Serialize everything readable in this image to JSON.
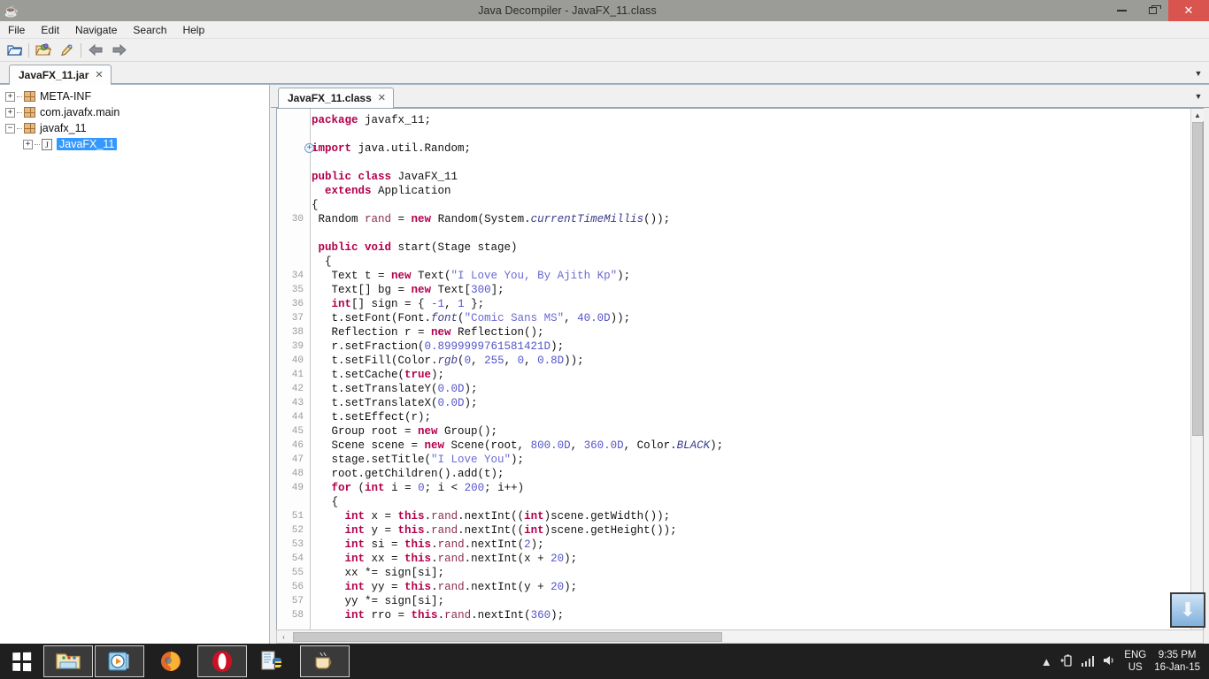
{
  "window": {
    "title": "Java Decompiler - JavaFX_11.class",
    "app_icon": "java-cup-icon",
    "controls": {
      "minimize": "minimize-icon",
      "restore": "restore-icon",
      "close": "✕"
    }
  },
  "menubar": {
    "items": [
      "File",
      "Edit",
      "Navigate",
      "Search",
      "Help"
    ]
  },
  "toolbar": {
    "items": [
      {
        "name": "open-file-icon",
        "glyph": "📂"
      },
      {
        "name": "open-type-icon",
        "glyph": "📁"
      },
      {
        "name": "pin-icon",
        "glyph": "🖊"
      },
      {
        "name": "back-arrow-icon",
        "glyph": "⬅"
      },
      {
        "name": "forward-arrow-icon",
        "glyph": "➡"
      }
    ]
  },
  "left_panel": {
    "tab": {
      "label": "JavaFX_11.jar",
      "close": "✕"
    },
    "dropdown": "▼",
    "tree": [
      {
        "label": "META-INF",
        "icon": "package-icon",
        "expander": "+",
        "level": 1,
        "selected": false
      },
      {
        "label": "com.javafx.main",
        "icon": "package-icon",
        "expander": "+",
        "level": 1,
        "selected": false
      },
      {
        "label": "javafx_11",
        "icon": "package-icon",
        "expander": "−",
        "level": 1,
        "selected": false
      },
      {
        "label": "JavaFX_11",
        "icon": "class-icon",
        "expander": "+",
        "level": 2,
        "selected": true,
        "icon_glyph": "J"
      }
    ]
  },
  "editor": {
    "tab": {
      "label": "JavaFX_11.class",
      "close": "✕"
    },
    "dropdown": "▼",
    "fold_marker": "+",
    "scroll": {
      "up": "▲",
      "down": "▼",
      "left": "‹",
      "right": "›"
    },
    "corner_widget": "⬇",
    "lines": [
      {
        "no": "",
        "fold": false,
        "tokens": [
          {
            "t": "package ",
            "c": "kw"
          },
          {
            "t": "javafx_11;",
            "c": "plain"
          }
        ]
      },
      {
        "no": "",
        "fold": false,
        "tokens": []
      },
      {
        "no": "",
        "fold": true,
        "tokens": [
          {
            "t": "import ",
            "c": "kw"
          },
          {
            "t": "java.util.Random;",
            "c": "plain"
          }
        ]
      },
      {
        "no": "",
        "fold": false,
        "tokens": []
      },
      {
        "no": "",
        "fold": false,
        "tokens": [
          {
            "t": "public class ",
            "c": "kw"
          },
          {
            "t": "JavaFX_11",
            "c": "plain"
          }
        ]
      },
      {
        "no": "",
        "fold": false,
        "tokens": [
          {
            "t": "  ",
            "c": "plain"
          },
          {
            "t": "extends ",
            "c": "kw"
          },
          {
            "t": "Application",
            "c": "plain"
          }
        ]
      },
      {
        "no": "",
        "fold": false,
        "tokens": [
          {
            "t": "{",
            "c": "plain"
          }
        ]
      },
      {
        "no": "30",
        "fold": false,
        "tokens": [
          {
            "t": " Random ",
            "c": "plain"
          },
          {
            "t": "rand",
            "c": "fld"
          },
          {
            "t": " = ",
            "c": "plain"
          },
          {
            "t": "new ",
            "c": "kw"
          },
          {
            "t": "Random(System.",
            "c": "plain"
          },
          {
            "t": "currentTimeMillis",
            "c": "sfield"
          },
          {
            "t": "());",
            "c": "plain"
          }
        ]
      },
      {
        "no": "",
        "fold": false,
        "tokens": []
      },
      {
        "no": "",
        "fold": false,
        "tokens": [
          {
            "t": " ",
            "c": "plain"
          },
          {
            "t": "public void ",
            "c": "kw"
          },
          {
            "t": "start(Stage stage)",
            "c": "plain"
          }
        ]
      },
      {
        "no": "",
        "fold": false,
        "tokens": [
          {
            "t": "  {",
            "c": "plain"
          }
        ]
      },
      {
        "no": "34",
        "fold": false,
        "tokens": [
          {
            "t": "   Text t = ",
            "c": "plain"
          },
          {
            "t": "new ",
            "c": "kw"
          },
          {
            "t": "Text(",
            "c": "plain"
          },
          {
            "t": "\"I Love You, By Ajith Kp\"",
            "c": "str"
          },
          {
            "t": ");",
            "c": "plain"
          }
        ]
      },
      {
        "no": "35",
        "fold": false,
        "tokens": [
          {
            "t": "   Text[] bg = ",
            "c": "plain"
          },
          {
            "t": "new ",
            "c": "kw"
          },
          {
            "t": "Text[",
            "c": "plain"
          },
          {
            "t": "300",
            "c": "num"
          },
          {
            "t": "];",
            "c": "plain"
          }
        ]
      },
      {
        "no": "36",
        "fold": false,
        "tokens": [
          {
            "t": "   ",
            "c": "plain"
          },
          {
            "t": "int",
            "c": "kw"
          },
          {
            "t": "[] sign = { ",
            "c": "plain"
          },
          {
            "t": "-1",
            "c": "num"
          },
          {
            "t": ", ",
            "c": "plain"
          },
          {
            "t": "1",
            "c": "num"
          },
          {
            "t": " };",
            "c": "plain"
          }
        ]
      },
      {
        "no": "37",
        "fold": false,
        "tokens": [
          {
            "t": "   t.setFont(Font.",
            "c": "plain"
          },
          {
            "t": "font",
            "c": "sfield"
          },
          {
            "t": "(",
            "c": "plain"
          },
          {
            "t": "\"Comic Sans MS\"",
            "c": "str"
          },
          {
            "t": ", ",
            "c": "plain"
          },
          {
            "t": "40.0D",
            "c": "num"
          },
          {
            "t": "));",
            "c": "plain"
          }
        ]
      },
      {
        "no": "38",
        "fold": false,
        "tokens": [
          {
            "t": "   Reflection r = ",
            "c": "plain"
          },
          {
            "t": "new ",
            "c": "kw"
          },
          {
            "t": "Reflection();",
            "c": "plain"
          }
        ]
      },
      {
        "no": "39",
        "fold": false,
        "tokens": [
          {
            "t": "   r.setFraction(",
            "c": "plain"
          },
          {
            "t": "0.8999999761581421D",
            "c": "num"
          },
          {
            "t": ");",
            "c": "plain"
          }
        ]
      },
      {
        "no": "40",
        "fold": false,
        "tokens": [
          {
            "t": "   t.setFill(Color.",
            "c": "plain"
          },
          {
            "t": "rgb",
            "c": "sfield"
          },
          {
            "t": "(",
            "c": "plain"
          },
          {
            "t": "0",
            "c": "num"
          },
          {
            "t": ", ",
            "c": "plain"
          },
          {
            "t": "255",
            "c": "num"
          },
          {
            "t": ", ",
            "c": "plain"
          },
          {
            "t": "0",
            "c": "num"
          },
          {
            "t": ", ",
            "c": "plain"
          },
          {
            "t": "0.8D",
            "c": "num"
          },
          {
            "t": "));",
            "c": "plain"
          }
        ]
      },
      {
        "no": "41",
        "fold": false,
        "tokens": [
          {
            "t": "   t.setCache(",
            "c": "plain"
          },
          {
            "t": "true",
            "c": "kw"
          },
          {
            "t": ");",
            "c": "plain"
          }
        ]
      },
      {
        "no": "42",
        "fold": false,
        "tokens": [
          {
            "t": "   t.setTranslateY(",
            "c": "plain"
          },
          {
            "t": "0.0D",
            "c": "num"
          },
          {
            "t": ");",
            "c": "plain"
          }
        ]
      },
      {
        "no": "43",
        "fold": false,
        "tokens": [
          {
            "t": "   t.setTranslateX(",
            "c": "plain"
          },
          {
            "t": "0.0D",
            "c": "num"
          },
          {
            "t": ");",
            "c": "plain"
          }
        ]
      },
      {
        "no": "44",
        "fold": false,
        "tokens": [
          {
            "t": "   t.setEffect(r);",
            "c": "plain"
          }
        ]
      },
      {
        "no": "45",
        "fold": false,
        "tokens": [
          {
            "t": "   Group root = ",
            "c": "plain"
          },
          {
            "t": "new ",
            "c": "kw"
          },
          {
            "t": "Group();",
            "c": "plain"
          }
        ]
      },
      {
        "no": "46",
        "fold": false,
        "tokens": [
          {
            "t": "   Scene scene = ",
            "c": "plain"
          },
          {
            "t": "new ",
            "c": "kw"
          },
          {
            "t": "Scene(root, ",
            "c": "plain"
          },
          {
            "t": "800.0D",
            "c": "num"
          },
          {
            "t": ", ",
            "c": "plain"
          },
          {
            "t": "360.0D",
            "c": "num"
          },
          {
            "t": ", Color.",
            "c": "plain"
          },
          {
            "t": "BLACK",
            "c": "sfield"
          },
          {
            "t": ");",
            "c": "plain"
          }
        ]
      },
      {
        "no": "47",
        "fold": false,
        "tokens": [
          {
            "t": "   stage.setTitle(",
            "c": "plain"
          },
          {
            "t": "\"I Love You\"",
            "c": "str"
          },
          {
            "t": ");",
            "c": "plain"
          }
        ]
      },
      {
        "no": "48",
        "fold": false,
        "tokens": [
          {
            "t": "   root.getChildren().add(t);",
            "c": "plain"
          }
        ]
      },
      {
        "no": "49",
        "fold": false,
        "tokens": [
          {
            "t": "   ",
            "c": "plain"
          },
          {
            "t": "for ",
            "c": "kw"
          },
          {
            "t": "(",
            "c": "plain"
          },
          {
            "t": "int",
            "c": "kw"
          },
          {
            "t": " i = ",
            "c": "plain"
          },
          {
            "t": "0",
            "c": "num"
          },
          {
            "t": "; i < ",
            "c": "plain"
          },
          {
            "t": "200",
            "c": "num"
          },
          {
            "t": "; i++)",
            "c": "plain"
          }
        ]
      },
      {
        "no": "",
        "fold": false,
        "tokens": [
          {
            "t": "   {",
            "c": "plain"
          }
        ]
      },
      {
        "no": "51",
        "fold": false,
        "tokens": [
          {
            "t": "     ",
            "c": "plain"
          },
          {
            "t": "int",
            "c": "kw"
          },
          {
            "t": " x = ",
            "c": "plain"
          },
          {
            "t": "this",
            "c": "kw"
          },
          {
            "t": ".",
            "c": "plain"
          },
          {
            "t": "rand",
            "c": "fld"
          },
          {
            "t": ".nextInt((",
            "c": "plain"
          },
          {
            "t": "int",
            "c": "kw"
          },
          {
            "t": ")scene.getWidth());",
            "c": "plain"
          }
        ]
      },
      {
        "no": "52",
        "fold": false,
        "tokens": [
          {
            "t": "     ",
            "c": "plain"
          },
          {
            "t": "int",
            "c": "kw"
          },
          {
            "t": " y = ",
            "c": "plain"
          },
          {
            "t": "this",
            "c": "kw"
          },
          {
            "t": ".",
            "c": "plain"
          },
          {
            "t": "rand",
            "c": "fld"
          },
          {
            "t": ".nextInt((",
            "c": "plain"
          },
          {
            "t": "int",
            "c": "kw"
          },
          {
            "t": ")scene.getHeight());",
            "c": "plain"
          }
        ]
      },
      {
        "no": "53",
        "fold": false,
        "tokens": [
          {
            "t": "     ",
            "c": "plain"
          },
          {
            "t": "int",
            "c": "kw"
          },
          {
            "t": " si = ",
            "c": "plain"
          },
          {
            "t": "this",
            "c": "kw"
          },
          {
            "t": ".",
            "c": "plain"
          },
          {
            "t": "rand",
            "c": "fld"
          },
          {
            "t": ".nextInt(",
            "c": "plain"
          },
          {
            "t": "2",
            "c": "num"
          },
          {
            "t": ");",
            "c": "plain"
          }
        ]
      },
      {
        "no": "54",
        "fold": false,
        "tokens": [
          {
            "t": "     ",
            "c": "plain"
          },
          {
            "t": "int",
            "c": "kw"
          },
          {
            "t": " xx = ",
            "c": "plain"
          },
          {
            "t": "this",
            "c": "kw"
          },
          {
            "t": ".",
            "c": "plain"
          },
          {
            "t": "rand",
            "c": "fld"
          },
          {
            "t": ".nextInt(x + ",
            "c": "plain"
          },
          {
            "t": "20",
            "c": "num"
          },
          {
            "t": ");",
            "c": "plain"
          }
        ]
      },
      {
        "no": "55",
        "fold": false,
        "tokens": [
          {
            "t": "     xx *= sign[si];",
            "c": "plain"
          }
        ]
      },
      {
        "no": "56",
        "fold": false,
        "tokens": [
          {
            "t": "     ",
            "c": "plain"
          },
          {
            "t": "int",
            "c": "kw"
          },
          {
            "t": " yy = ",
            "c": "plain"
          },
          {
            "t": "this",
            "c": "kw"
          },
          {
            "t": ".",
            "c": "plain"
          },
          {
            "t": "rand",
            "c": "fld"
          },
          {
            "t": ".nextInt(y + ",
            "c": "plain"
          },
          {
            "t": "20",
            "c": "num"
          },
          {
            "t": ");",
            "c": "plain"
          }
        ]
      },
      {
        "no": "57",
        "fold": false,
        "tokens": [
          {
            "t": "     yy *= sign[si];",
            "c": "plain"
          }
        ]
      },
      {
        "no": "58",
        "fold": false,
        "tokens": [
          {
            "t": "     ",
            "c": "plain"
          },
          {
            "t": "int",
            "c": "kw"
          },
          {
            "t": " rro = ",
            "c": "plain"
          },
          {
            "t": "this",
            "c": "kw"
          },
          {
            "t": ".",
            "c": "plain"
          },
          {
            "t": "rand",
            "c": "fld"
          },
          {
            "t": ".nextInt(",
            "c": "plain"
          },
          {
            "t": "360",
            "c": "num"
          },
          {
            "t": ");",
            "c": "plain"
          }
        ]
      }
    ]
  },
  "taskbar": {
    "start": "windows-start-icon",
    "apps": [
      {
        "name": "file-explorer-icon",
        "glyph": "🗂",
        "active": true
      },
      {
        "name": "media-player-icon",
        "glyph": "▶",
        "active": true
      },
      {
        "name": "firefox-icon",
        "glyph": "🦊",
        "active": false
      },
      {
        "name": "opera-icon",
        "glyph": "O",
        "active": true
      },
      {
        "name": "python-icon",
        "glyph": "🐍",
        "active": false
      },
      {
        "name": "java-decompiler-icon",
        "glyph": "☕",
        "active": true
      }
    ],
    "tray": {
      "show_hidden": "▲",
      "battery": "battery-icon",
      "network": "signal-icon",
      "volume": "🔊",
      "language_line1": "ENG",
      "language_line2": "US",
      "time": "9:35 PM",
      "date": "16-Jan-15"
    }
  },
  "colors": {
    "keyword": "#b3004c",
    "string": "#6a6ad4",
    "number": "#5454c9",
    "selection": "#3399ff",
    "close_button": "#d9534f",
    "titlebar": "#9b9b97",
    "taskbar": "#1f1f1f"
  }
}
